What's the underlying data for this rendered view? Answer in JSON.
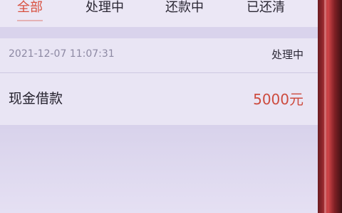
{
  "tabs": [
    {
      "label": "全部",
      "active": true
    },
    {
      "label": "处理中",
      "active": false
    },
    {
      "label": "还款中",
      "active": false
    },
    {
      "label": "已还清",
      "active": false
    }
  ],
  "record": {
    "datetime": "2021-12-07 11:07:31",
    "status": "处理中",
    "loan_type": "现金借款",
    "amount": "5000元"
  },
  "colors": {
    "accent": "#d8503f",
    "amount": "#cd4b3e",
    "background": "#e6e1f3"
  }
}
